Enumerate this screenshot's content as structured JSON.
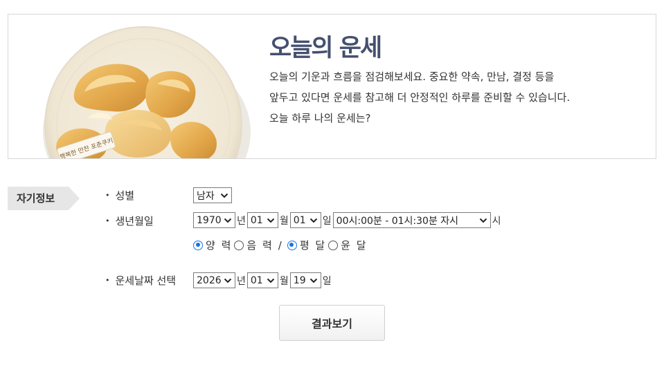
{
  "banner": {
    "title": "오늘의 운세",
    "desc_lines": [
      "오늘의 기운과 흐름을 점검해보세요. 중요한 약속, 만남, 결정 등을",
      "앞두고 있다면 운세를 참고해 더 안정적인 하루를 준비할 수 있습니다.",
      "오늘 하루 나의 운세는?"
    ],
    "tag_text": "행복한 만찬 포춘쿠키"
  },
  "section": {
    "tag": "자기정보"
  },
  "form": {
    "gender": {
      "label": "성별",
      "value": "남자"
    },
    "birth": {
      "label": "생년월일",
      "year": "1970",
      "year_unit": "년",
      "month": "01",
      "month_unit": "월",
      "day": "01",
      "day_unit": "일",
      "time": "00시:00분 - 01시:30분 자시",
      "time_unit": "시"
    },
    "calendar": {
      "solar": "양 력",
      "lunar": "음 력",
      "separator": "/",
      "normal": "평 달",
      "leap": "윤 달",
      "solar_selected": true,
      "normal_selected": true
    },
    "fortune_date": {
      "label": "운세날짜 선택",
      "year": "2026",
      "year_unit": "년",
      "month": "01",
      "month_unit": "월",
      "day": "19",
      "day_unit": "일"
    }
  },
  "submit_label": "결과보기",
  "colors": {
    "title": "#45506f",
    "radio_accent": "#1a73e8",
    "tag_bg": "#e6e6e6"
  }
}
